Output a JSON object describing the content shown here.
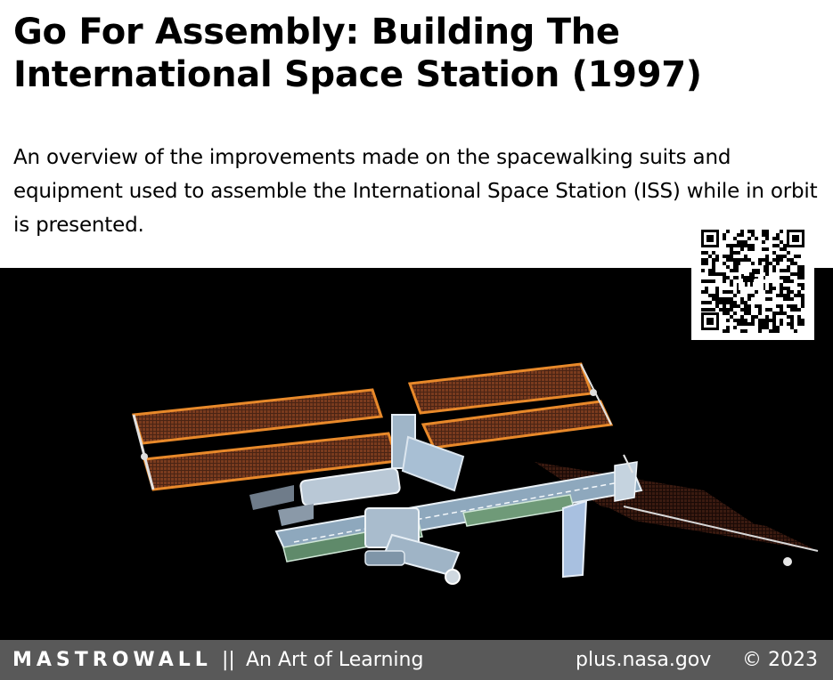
{
  "title": "Go For Assembly: Building The International Space Station (1997)",
  "description": "An overview of the improvements made on the spacewalking suits and equipment used to assemble the International Space Station (ISS) while in orbit is presented.",
  "footer": {
    "brand": "MASTROWALL",
    "separator": "||",
    "tagline": "An Art of Learning",
    "source": "plus.nasa.gov",
    "copyright": "© 2023"
  },
  "icons": {
    "qr": "qr-code-icon",
    "dino": "dinosaur-icon"
  },
  "colors": {
    "footer_bg": "#595959",
    "photo_bg": "#000000",
    "panel_orange": "#e8892a"
  }
}
